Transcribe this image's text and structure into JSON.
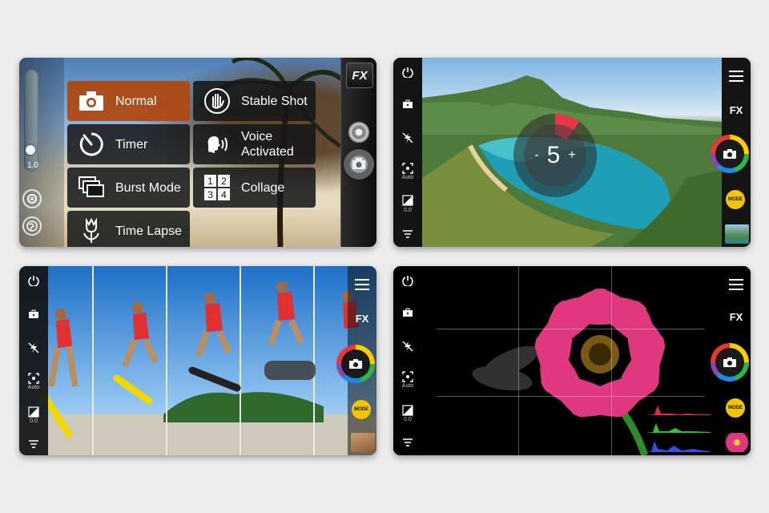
{
  "panel1": {
    "zoom_value": "1.0",
    "fx_label": "FX",
    "modes": [
      {
        "label": "Normal",
        "icon": "camera-icon",
        "active": true
      },
      {
        "label": "Stable Shot",
        "icon": "hand-icon",
        "active": false
      },
      {
        "label": "Timer",
        "icon": "timer-icon",
        "active": false
      },
      {
        "label": "Voice Activated",
        "icon": "voice-icon",
        "active": false
      },
      {
        "label": "Burst Mode",
        "icon": "burst-icon",
        "active": false
      },
      {
        "label": "Collage",
        "icon": "collage-icon",
        "active": false
      },
      {
        "label": "Time Lapse",
        "icon": "tulip-icon",
        "active": false
      }
    ],
    "collage_digits": [
      "1",
      "2",
      "3",
      "4"
    ]
  },
  "panel2": {
    "timer_minus": "-",
    "timer_value": "5",
    "timer_plus": "+",
    "auto_label": "Auto",
    "exposure_value": "0.0",
    "fx_label": "FX",
    "mode_label": "MODE"
  },
  "panel3": {
    "auto_label": "Auto",
    "exposure_value": "0.0",
    "fx_label": "FX",
    "mode_label": "MODE"
  },
  "panel4": {
    "auto_label": "Auto",
    "exposure_value": "0.0",
    "fx_label": "FX",
    "mode_label": "MODE"
  },
  "colors": {
    "active_mode": "#b0460e",
    "mode_button": "#f5c400",
    "ring": [
      "#ffcc00",
      "#2fb34a",
      "#1e88e5",
      "#8e44ad",
      "#e53935"
    ]
  }
}
